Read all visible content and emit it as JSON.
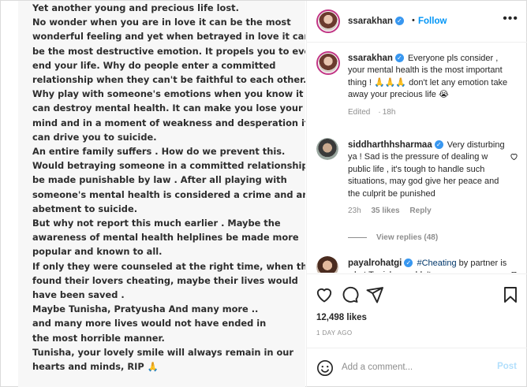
{
  "post_image": {
    "lines": [
      "Yet another young and precious life lost.",
      "No wonder when you are in love it can be the most",
      "wonderful feeling and yet when betrayed in love it can",
      "be the most destructive emotion. It propels you to even",
      "end your life. Why do people enter a committed",
      "relationship when they can't be faithful to each other.",
      "Why play with someone's emotions when you know it",
      "can destroy mental health. It can make you lose your",
      "mind and in a moment of weakness and desperation it",
      "can drive you to suicide.",
      "An entire family suffers . How do we prevent this.",
      "Would betraying someone in a committed relationship",
      "be made punishable by law . After all playing with",
      "someone's mental health is considered a crime and an",
      "abetment to suicide.",
      "But why not report this much earlier . Maybe the",
      "awareness of mental health helplines be made more",
      "popular and known to all.",
      "If only they were counseled at the right time, when they",
      "found their lovers cheating, maybe their lives would",
      "have been saved .",
      "Maybe Tunisha, Pratyusha And many more ..",
      "and many more lives would not have ended in",
      "the most horrible manner.",
      "Tunisha, your lovely smile will always remain in our",
      "hearts and minds, RIP 🙏"
    ]
  },
  "header": {
    "username": "ssarakhan",
    "verified_glyph": "✓",
    "dot": "•",
    "follow_label": "Follow",
    "more_label": "•••"
  },
  "caption": {
    "username": "ssarakhan",
    "text": "Everyone pls consider , your mental health is the most important thing ! 🙏🙏🙏 don't let any emotion take away your precious life 😭",
    "meta_edited": "Edited",
    "meta_time": "18h"
  },
  "comments": [
    {
      "username": "siddharthhsharmaa",
      "text": "Very disturbing ya ! Sad is the pressure of dealing w public life , it's tough to handle such situations, may god give her peace and the culprit be punished",
      "time": "23h",
      "likes": "35 likes",
      "reply_label": "Reply",
      "view_replies": "View replies (48)"
    },
    {
      "username": "payalrohatgi",
      "tag": "#Cheating",
      "text": "by partner is what Tunisha couldn't"
    }
  ],
  "stats": {
    "likes": "12,498 likes",
    "date": "1 DAY AGO"
  },
  "add_comment": {
    "placeholder": "Add a comment...",
    "post_label": "Post"
  },
  "icons": [
    "heart-icon",
    "comment-icon",
    "share-icon",
    "bookmark-icon",
    "emoji-icon",
    "more-icon",
    "verified-icon"
  ],
  "colors": {
    "link_blue": "#0095f6",
    "verified_blue": "#3897f0",
    "muted": "#8e8e8e",
    "text": "#262626",
    "post_disabled": "#b2dffc"
  }
}
